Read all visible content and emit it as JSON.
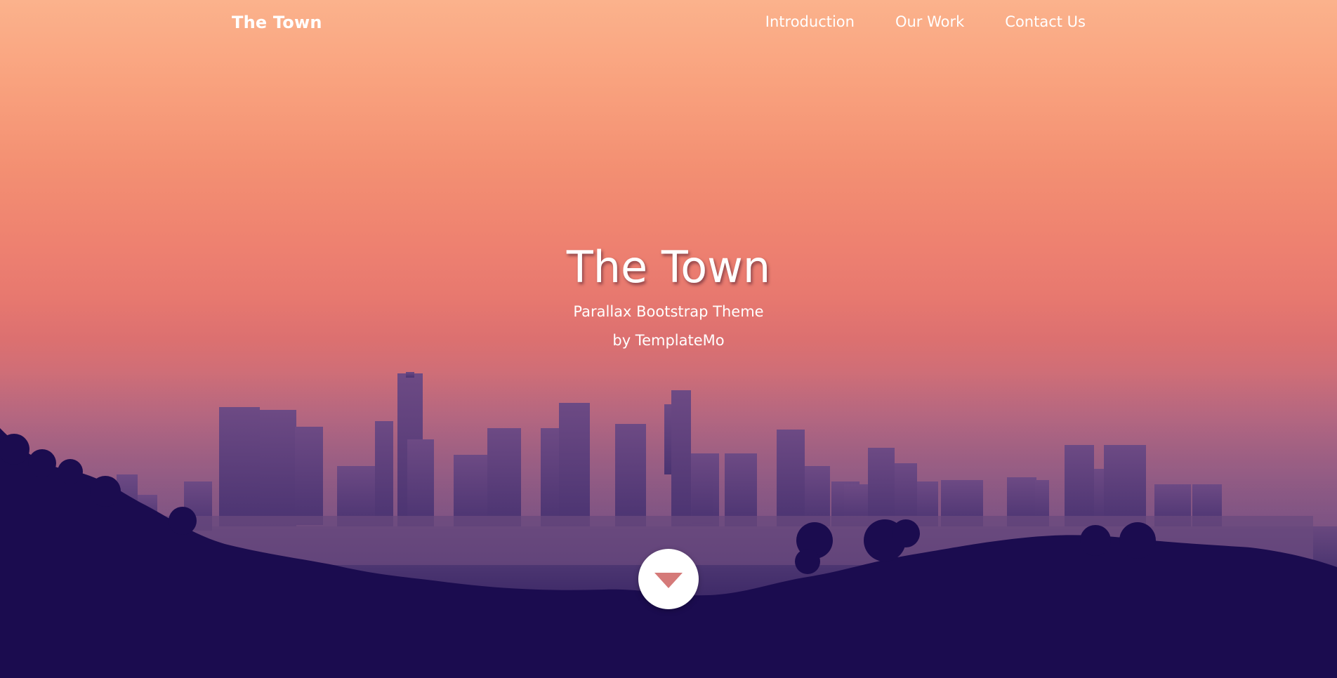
{
  "navbar": {
    "brand": "The Town",
    "links": [
      {
        "label": "Introduction"
      },
      {
        "label": "Our Work"
      },
      {
        "label": "Contact Us"
      }
    ]
  },
  "hero": {
    "title": "The Town",
    "subtitle": "Parallax Bootstrap Theme",
    "byline": "by TemplateMo",
    "scroll_icon": "chevron-down-icon"
  },
  "colors": {
    "sky_top": "#fbb28c",
    "sky_mid": "#ee8170",
    "silhouette": "#1b0c4f",
    "buildings": "#5a3a78",
    "arrow": "#d57a79"
  }
}
